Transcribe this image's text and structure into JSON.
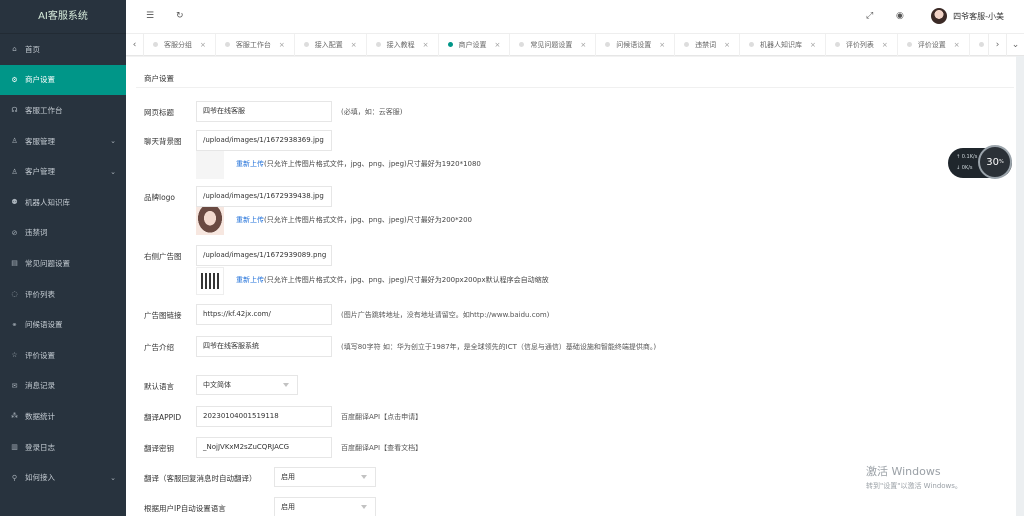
{
  "app": {
    "title": "AI客服系统"
  },
  "sidebar": {
    "items": [
      {
        "label": "首页",
        "icon": "home-icon"
      },
      {
        "label": "商户设置",
        "icon": "gear-icon",
        "active": true
      },
      {
        "label": "客服工作台",
        "icon": "headset-icon"
      },
      {
        "label": "客服管理",
        "icon": "user-icon",
        "arrow": true
      },
      {
        "label": "客户管理",
        "icon": "user-icon",
        "arrow": true
      },
      {
        "label": "机器人知识库",
        "icon": "robot-icon"
      },
      {
        "label": "违禁词",
        "icon": "block-icon"
      },
      {
        "label": "常见问题设置",
        "icon": "doc-icon"
      },
      {
        "label": "评价列表",
        "icon": "comment-icon"
      },
      {
        "label": "问候语设置",
        "icon": "link-icon"
      },
      {
        "label": "评价设置",
        "icon": "star-icon"
      },
      {
        "label": "消息记录",
        "icon": "message-icon"
      },
      {
        "label": "数据统计",
        "icon": "chart-icon"
      },
      {
        "label": "登录日志",
        "icon": "log-icon"
      },
      {
        "label": "如何接入",
        "icon": "plug-icon",
        "arrow": true
      }
    ]
  },
  "header": {
    "menu_icon": "☰",
    "refresh_icon": "↻",
    "fullscreen_icon": "⤢",
    "theme_icon": "◉",
    "username": "四爷客服-小美"
  },
  "tabs": {
    "items": [
      {
        "label": "客服分组"
      },
      {
        "label": "客服工作台"
      },
      {
        "label": "接入配置"
      },
      {
        "label": "接入教程"
      },
      {
        "label": "商户设置",
        "active": true
      },
      {
        "label": "常见问题设置"
      },
      {
        "label": "问候语设置"
      },
      {
        "label": "违禁词"
      },
      {
        "label": "机器人知识库"
      },
      {
        "label": "评价列表"
      },
      {
        "label": "评价设置"
      },
      {
        "label": "装"
      }
    ]
  },
  "form": {
    "panel_title": "商户设置",
    "web_title": {
      "label": "网页标题",
      "value": "四爷在线客服",
      "hint": "(必填，如：云客服)"
    },
    "chat_bg": {
      "label": "聊天背景图",
      "value": "/upload/images/1/1672938369.jpg",
      "upload_link": "重新上传",
      "upload_hint": "(只允许上传图片格式文件，jpg、png、jpeg)尺寸最好为1920*1080"
    },
    "brand_logo": {
      "label": "品牌logo",
      "value": "/upload/images/1/1672939438.jpg",
      "upload_link": "重新上传",
      "upload_hint": "(只允许上传图片格式文件，jpg、png、jpeg)尺寸最好为200*200"
    },
    "right_ad": {
      "label": "右侧广告图",
      "value": "/upload/images/1/1672939089.png",
      "upload_link": "重新上传",
      "upload_hint": "(只允许上传图片格式文件，jpg、png、jpeg)尺寸最好为200px200px默认程序会自动缩放"
    },
    "ad_link": {
      "label": "广告图链接",
      "value": "https://kf.42jx.com/",
      "hint": "(图片广告跳转地址，没有地址请留空。如http://www.baidu.com)"
    },
    "ad_intro": {
      "label": "广告介绍",
      "value": "四爷在线客服系统",
      "hint": "(填写80字符 如：华为创立于1987年，是全球领先的ICT（信息与通信）基础设施和智能终端提供商。)"
    },
    "default_lang": {
      "label": "默认语言",
      "value": "中文简体"
    },
    "translate_appid": {
      "label": "翻译APPID",
      "value": "20230104001519118",
      "hint": "百度翻译API【点击申请】"
    },
    "translate_key": {
      "label": "翻译密钥",
      "value": "_NojJVKxM2sZuCQRJACG",
      "hint": "百度翻译API【查看文档】"
    },
    "translate_auto": {
      "label": "翻译（客服回复消息时自动翻译）",
      "value": "启用"
    },
    "ip_lang": {
      "label": "根据用户IP自动设置语言",
      "value": "启用"
    }
  },
  "widget": {
    "upload": "0.1",
    "download": "0",
    "unit": "K/s",
    "percent": "30",
    "percent_unit": "%"
  },
  "watermark": {
    "line1": "激活 Windows",
    "line2": "转到\"设置\"以激活 Windows。"
  }
}
